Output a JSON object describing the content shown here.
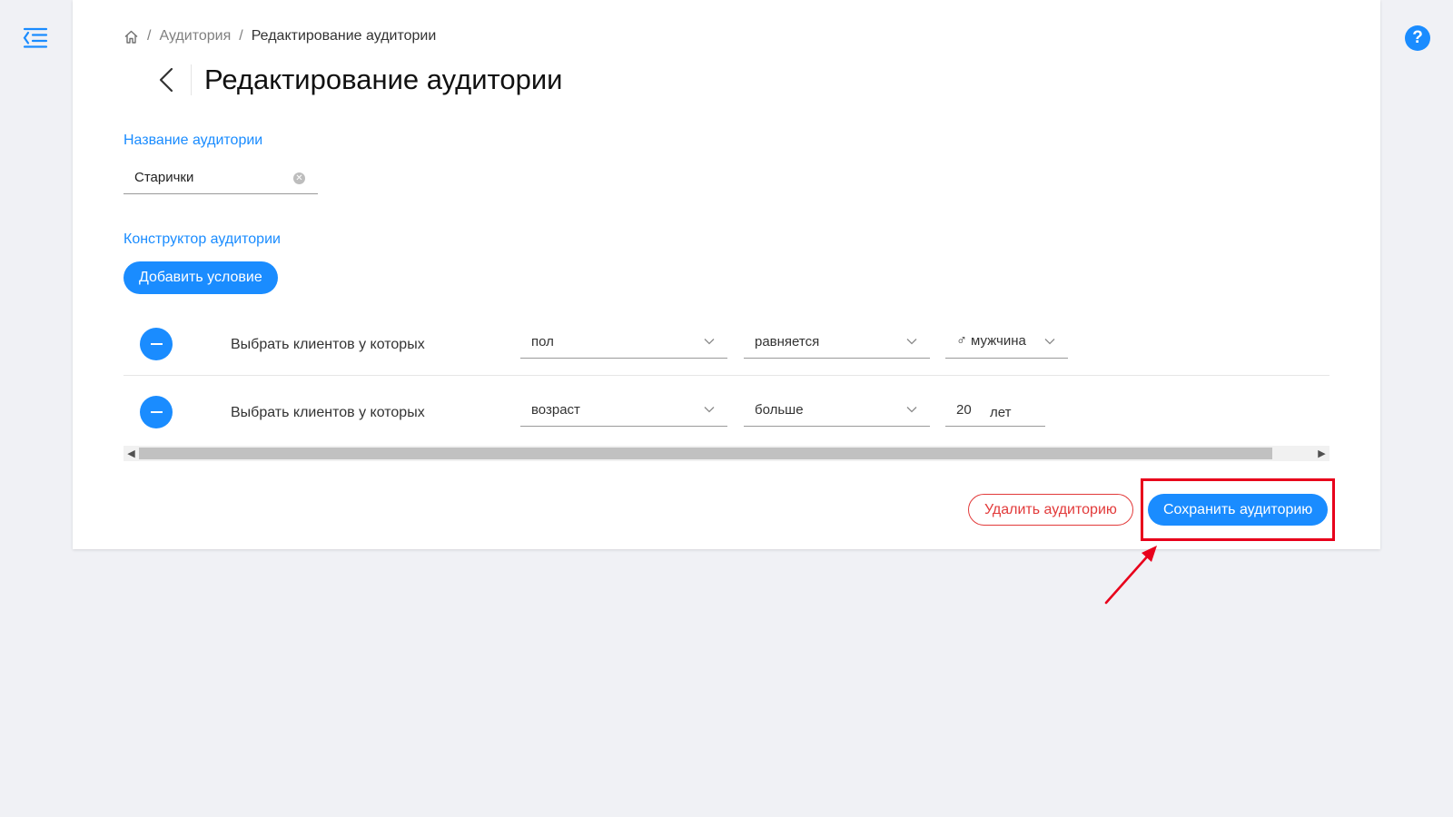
{
  "breadcrumb": {
    "home_icon": "home-icon",
    "separator": "/",
    "items": [
      "Аудитория",
      "Редактирование аудитории"
    ]
  },
  "page": {
    "title": "Редактирование аудитории"
  },
  "name_section": {
    "label": "Название аудитории",
    "value": "Старички"
  },
  "builder": {
    "label": "Конструктор аудитории",
    "add_button": "Добавить условие",
    "rules": [
      {
        "prefix": "Выбрать клиентов у которых",
        "field": "пол",
        "operator": "равняется",
        "value": "мужчина",
        "value_icon": "♂"
      },
      {
        "prefix": "Выбрать клиентов у которых",
        "field": "возраст",
        "operator": "больше",
        "value": "20",
        "unit": "лет"
      }
    ]
  },
  "actions": {
    "delete": "Удалить аудиторию",
    "save": "Сохранить аудиторию"
  },
  "colors": {
    "accent": "#1a8cff",
    "danger": "#e23a3a",
    "annotation": "#e8001b",
    "background": "#f0f1f5"
  }
}
